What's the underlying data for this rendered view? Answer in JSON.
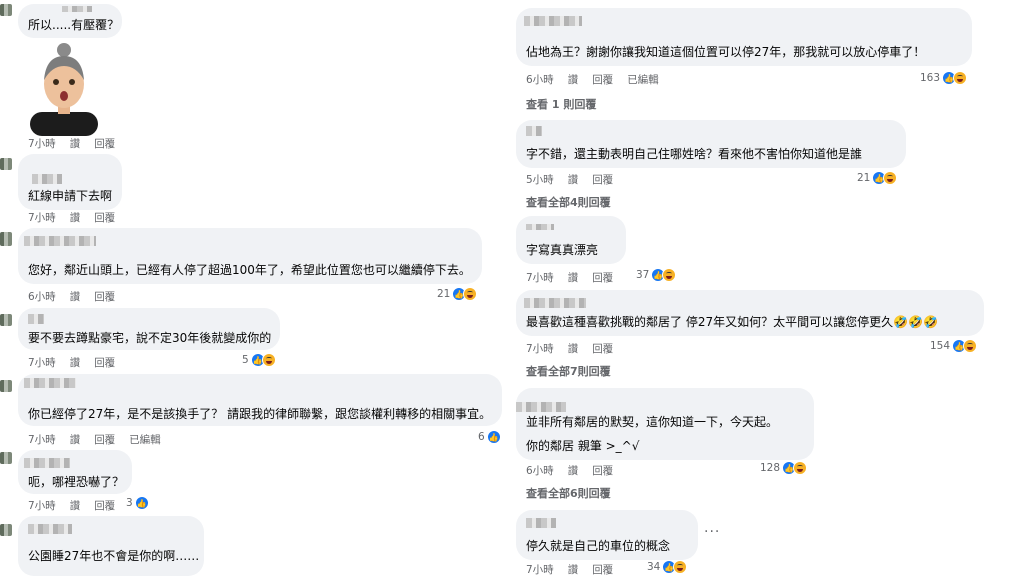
{
  "actions": {
    "like": "讚",
    "reply": "回覆",
    "edited": "已編輯"
  },
  "left": [
    {
      "text": "所以.....有壓覆？",
      "time": "7小時",
      "reaction_count": null
    },
    {
      "text": "紅線申請下去啊",
      "time": "7小時",
      "reaction_count": null
    },
    {
      "text": "您好，鄰近山頭上，已經有人停了超過100年了，希望此位置您也可以繼續停下去。",
      "time": "6小時",
      "reaction_count": "21"
    },
    {
      "text": "要不要去蹲點豪宅，說不定30年後就變成你的",
      "time": "7小時",
      "reaction_count": "5"
    },
    {
      "text": "你已經停了27年，是不是該換手了？ 請跟我的律師聯繫，跟您談權利轉移的相關事宜。",
      "time": "7小時",
      "reaction_count": "6"
    },
    {
      "text": "呃，哪裡恐嚇了？",
      "time": "7小時",
      "reaction_count": "3"
    },
    {
      "text": "公園睡27年也不會是你的啊……",
      "time": "",
      "reaction_count": null
    }
  ],
  "right": [
    {
      "text": "佔地為王？謝謝你讓我知道這個位置可以停27年，那我就可以放心停車了！",
      "time": "6小時",
      "reaction_count": "163",
      "more": "查看 1 則回覆"
    },
    {
      "text": "字不錯，還主動表明自己住哪姓啥？看來他不害怕你知道他是誰",
      "time": "5小時",
      "reaction_count": "21",
      "more": "查看全部4則回覆"
    },
    {
      "text": "字寫真真漂亮",
      "time": "7小時",
      "reaction_count": "37",
      "more": ""
    },
    {
      "text": "最喜歡這種喜歡挑戰的鄰居了 停27年又如何？太平間可以讓您停更久🤣🤣🤣",
      "time": "7小時",
      "reaction_count": "154",
      "more": "查看全部7則回覆"
    },
    {
      "text": "並非所有鄰居的默契，這你知道一下，今天起。",
      "text2": "你的鄰居 親筆 >_^√",
      "time": "6小時",
      "reaction_count": "128",
      "more": "查看全部6則回覆"
    },
    {
      "text": "停久就是自己的車位的概念",
      "time": "7小時",
      "reaction_count": "34",
      "more": ""
    }
  ]
}
